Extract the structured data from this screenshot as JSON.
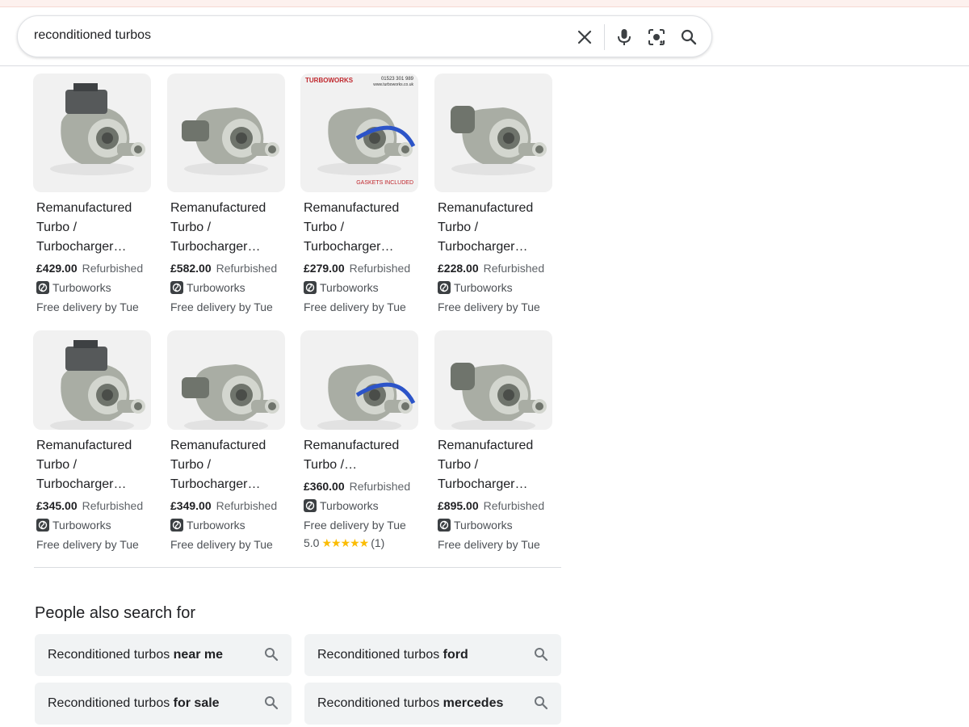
{
  "search": {
    "query": "reconditioned turbos"
  },
  "icons": {
    "clear": "close-icon",
    "voice": "microphone-icon",
    "lens": "lens-camera-icon",
    "search": "search-icon"
  },
  "colors": {
    "star": "#fbbc04",
    "pill_bg": "#f1f3f4",
    "text": "#202124",
    "muted": "#5f6368"
  },
  "products": [
    {
      "title_lines": [
        "Remanufactured",
        "Turbo /",
        "Turbocharger…"
      ],
      "price": "£429.00",
      "condition": "Refurbished",
      "seller": "Turboworks",
      "delivery": "Free delivery by Tue"
    },
    {
      "title_lines": [
        "Remanufactured",
        "Turbo /",
        "Turbocharger…"
      ],
      "price": "£582.00",
      "condition": "Refurbished",
      "seller": "Turboworks",
      "delivery": "Free delivery by Tue"
    },
    {
      "title_lines": [
        "Remanufactured",
        "Turbo /",
        "Turbocharger…"
      ],
      "price": "£279.00",
      "condition": "Refurbished",
      "seller": "Turboworks",
      "delivery": "Free delivery by Tue",
      "image_text": {
        "brand": "TURBOWORKS",
        "phone": "01523 301 989",
        "site": "www.turboworks.co.uk",
        "banner": "GASKETS INCLUDED"
      }
    },
    {
      "title_lines": [
        "Remanufactured",
        "Turbo /",
        "Turbocharger…"
      ],
      "price": "£228.00",
      "condition": "Refurbished",
      "seller": "Turboworks",
      "delivery": "Free delivery by Tue"
    },
    {
      "title_lines": [
        "Remanufactured",
        "Turbo /",
        "Turbocharger…"
      ],
      "price": "£345.00",
      "condition": "Refurbished",
      "seller": "Turboworks",
      "delivery": "Free delivery by Tue"
    },
    {
      "title_lines": [
        "Remanufactured",
        "Turbo /",
        "Turbocharger…"
      ],
      "price": "£349.00",
      "condition": "Refurbished",
      "seller": "Turboworks",
      "delivery": "Free delivery by Tue"
    },
    {
      "title_lines": [
        "Remanufactured",
        "Turbo /…"
      ],
      "price": "£360.00",
      "condition": "Refurbished",
      "seller": "Turboworks",
      "delivery": "Free delivery by Tue",
      "rating": "5.0",
      "stars": "★★★★★",
      "review_count": "(1)"
    },
    {
      "title_lines": [
        "Remanufactured",
        "Turbo /",
        "Turbocharger…"
      ],
      "price": "£895.00",
      "condition": "Refurbished",
      "seller": "Turboworks",
      "delivery": "Free delivery by Tue"
    }
  ],
  "people_also_search": {
    "heading": "People also search for",
    "items": [
      {
        "prefix": "Reconditioned turbos ",
        "bold": "near me"
      },
      {
        "prefix": "Reconditioned turbos ",
        "bold": "ford"
      },
      {
        "prefix": "Reconditioned turbos ",
        "bold": "for sale"
      },
      {
        "prefix": "Reconditioned turbos ",
        "bold": "mercedes"
      }
    ]
  }
}
